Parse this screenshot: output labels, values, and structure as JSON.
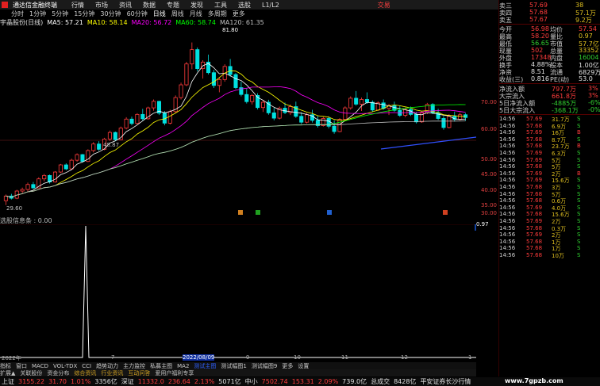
{
  "menubar": {
    "brand": "通达信金融终端",
    "items": [
      "行情",
      "市场",
      "资讯",
      "数据",
      "专题",
      "发现",
      "工具",
      "选股",
      "L1/L2"
    ],
    "trade": "交易"
  },
  "periods": [
    "分时",
    "1分钟",
    "5分钟",
    "15分钟",
    "30分钟",
    "60分钟",
    "日线",
    "周线",
    "月线",
    "多周期",
    "更多"
  ],
  "selected_period": "日线",
  "ma_legend": {
    "stock": "宇晶股份(日线)",
    "items": [
      {
        "label": "MA5: 57.21",
        "color": "#ffffff"
      },
      {
        "label": "MA10: 58.14",
        "color": "#ffff00"
      },
      {
        "label": "MA20: 56.72",
        "color": "#ff00ff"
      },
      {
        "label": "MA60: 58.74",
        "color": "#00ff00"
      },
      {
        "label": "MA120: 61.35",
        "color": "#c0c0c0"
      }
    ]
  },
  "price_axis": [
    "70.00",
    "60.00",
    "50.00",
    "45.00",
    "40.00",
    "35.00",
    "30.00"
  ],
  "annotations": {
    "high": "81.80",
    "mid": "48.87",
    "low": "29.60",
    "ref": "0.97"
  },
  "sub_legend": "选股信息条 : 0.00",
  "dates": [
    "2022年",
    "7",
    "2022/08/09",
    "9",
    "10",
    "11",
    "12",
    "1"
  ],
  "tabs": [
    "指标",
    "窗口",
    "MACD",
    "VOL-TDX",
    "CCI",
    "趋势动力",
    "主力监控",
    "私募主图",
    "MA2",
    "测试主图",
    "测试幅图1",
    "测试幅图9",
    "更多",
    "设置"
  ],
  "bottom_tabs": [
    "扩展▲",
    "关联股份",
    "资金分布",
    "综合资讯",
    "行业资讯",
    "互动问答",
    "爱用户福利专享"
  ],
  "indexes": [
    {
      "name": "上证",
      "value": "3155.22",
      "change": "31.70",
      "pct": "1.01%",
      "amount": "3356亿"
    },
    {
      "name": "深证",
      "value": "11332.0",
      "change": "236.64",
      "pct": "2.13%",
      "amount": "5071亿"
    },
    {
      "name": "中小",
      "value": "7502.74",
      "change": "153.31",
      "pct": "2.09%",
      "amount": "739.0亿"
    }
  ],
  "total_amount": {
    "label": "总成交",
    "value": "8428亿"
  },
  "status_text": "平安证券长沙行情",
  "quotes": {
    "asks": [
      {
        "label": "卖三",
        "price": "57.69",
        "vol": "38"
      },
      {
        "label": "卖四",
        "price": "57.68",
        "vol": "57.1万"
      },
      {
        "label": "卖五",
        "price": "57.67",
        "vol": "9.2万"
      }
    ],
    "stats": [
      {
        "l1": "今开",
        "v1": "56.98",
        "l2": "均价",
        "v2": "57.54"
      },
      {
        "l1": "最高",
        "v1": "58.20",
        "l2": "量比",
        "v2": "0.97"
      },
      {
        "l1": "最低",
        "v1": "56.65",
        "l2": "市值",
        "v2": "57.7亿"
      },
      {
        "l1": "现量",
        "v1": "502",
        "l2": "总量",
        "v2": "33352"
      },
      {
        "l1": "外盘",
        "v1": "17348",
        "l2": "内盘",
        "v2": "16004"
      },
      {
        "l1": "换手",
        "v1": "4.88%",
        "l2": "股本",
        "v2": "1.00亿"
      },
      {
        "l1": "净资",
        "v1": "8.51",
        "l2": "流通",
        "v2": "6829万"
      },
      {
        "l1": "收益(三)",
        "v1": "0.816",
        "l2": "PE(动)",
        "v2": "53.0"
      }
    ],
    "flows": [
      {
        "label": "净流入额",
        "value": "797.7万",
        "pct": "3%"
      },
      {
        "label": "大宗流入",
        "value": "661.8万",
        "pct": "3%"
      },
      {
        "label": "5日净流入额",
        "value": "-4885万",
        "pct": "-6%"
      },
      {
        "label": "5日大宗流入",
        "value": "-368.1万",
        "pct": "-0%"
      }
    ]
  },
  "ticks": [
    {
      "t": "14:56",
      "p": "57.69",
      "v": "31.7万",
      "s": "S"
    },
    {
      "t": "14:56",
      "p": "57.68",
      "v": "6.9万",
      "s": "S"
    },
    {
      "t": "14:56",
      "p": "57.69",
      "v": "16万",
      "s": "B"
    },
    {
      "t": "14:56",
      "p": "57.68",
      "v": "8.7万",
      "s": "S"
    },
    {
      "t": "14:56",
      "p": "57.68",
      "v": "23.7万",
      "s": "B"
    },
    {
      "t": "14:56",
      "p": "57.69",
      "v": "6.3万",
      "s": "S"
    },
    {
      "t": "14:56",
      "p": "57.69",
      "v": "5万",
      "s": "S"
    },
    {
      "t": "14:56",
      "p": "57.68",
      "v": "5万",
      "s": "S"
    },
    {
      "t": "14:56",
      "p": "57.69",
      "v": "2万",
      "s": "B"
    },
    {
      "t": "14:56",
      "p": "57.69",
      "v": "15.6万",
      "s": "S"
    },
    {
      "t": "14:56",
      "p": "57.68",
      "v": "3万",
      "s": "S"
    },
    {
      "t": "14:56",
      "p": "57.68",
      "v": "5万",
      "s": "S"
    },
    {
      "t": "14:56",
      "p": "57.68",
      "v": "0.6万",
      "s": "S"
    },
    {
      "t": "14:56",
      "p": "57.69",
      "v": "4.0万",
      "s": "S"
    },
    {
      "t": "14:56",
      "p": "57.68",
      "v": "15.6万",
      "s": "S"
    },
    {
      "t": "14:56",
      "p": "57.69",
      "v": "2万",
      "s": "S"
    },
    {
      "t": "14:56",
      "p": "57.68",
      "v": "0.3万",
      "s": "S"
    },
    {
      "t": "14:56",
      "p": "57.69",
      "v": "2万",
      "s": "S"
    },
    {
      "t": "14:56",
      "p": "57.68",
      "v": "1万",
      "s": "S"
    },
    {
      "t": "14:56",
      "p": "57.68",
      "v": "1万",
      "s": "S"
    },
    {
      "t": "14:56",
      "p": "57.68",
      "v": "10万",
      "s": "S"
    }
  ],
  "watermark": "www.7gpzb.com",
  "chart_data": {
    "type": "candlestick",
    "ylim": [
      28,
      85
    ],
    "candles": [
      [
        31,
        33,
        29.6,
        32.5
      ],
      [
        32.5,
        33.2,
        31.4,
        31.8
      ],
      [
        31.8,
        34.5,
        31.5,
        34.1
      ],
      [
        34.1,
        35.2,
        33.5,
        34.6
      ],
      [
        34.6,
        36.8,
        34,
        36.2
      ],
      [
        36.2,
        37,
        34.8,
        35.1
      ],
      [
        35.1,
        38.5,
        35,
        38
      ],
      [
        38,
        39.6,
        37.2,
        39.1
      ],
      [
        39.1,
        39.4,
        36.5,
        37
      ],
      [
        37,
        40.5,
        36.8,
        40.2
      ],
      [
        40.2,
        42.8,
        39.9,
        42.5
      ],
      [
        42.5,
        43,
        40.8,
        41.2
      ],
      [
        41.2,
        44.5,
        41,
        44
      ],
      [
        44,
        46.2,
        43.5,
        45.8
      ],
      [
        45.8,
        46,
        43.2,
        43.6
      ],
      [
        43.6,
        47.5,
        43.4,
        47.1
      ],
      [
        47.1,
        49.8,
        46.5,
        49.2
      ],
      [
        49.2,
        50.1,
        47,
        47.5
      ],
      [
        47.5,
        51.2,
        47.2,
        50.8
      ],
      [
        50.8,
        53.5,
        50.2,
        52.9
      ],
      [
        52.9,
        53.2,
        50.1,
        50.6
      ],
      [
        50.6,
        54.8,
        50.4,
        54.3
      ],
      [
        54.3,
        57.8,
        53.9,
        57.2
      ],
      [
        57.2,
        58,
        55.2,
        55.8
      ],
      [
        55.8,
        59.1,
        55.5,
        58.7
      ],
      [
        58.7,
        60.5,
        56.8,
        57.3
      ],
      [
        57.3,
        61.2,
        57,
        60.8
      ],
      [
        60.8,
        63.5,
        59.9,
        62.9
      ],
      [
        62.9,
        63.1,
        58.5,
        59.1
      ],
      [
        59.1,
        59.8,
        55.2,
        55.9
      ],
      [
        55.9,
        60.2,
        55.5,
        59.6
      ],
      [
        59.6,
        64.8,
        59.2,
        64.1
      ],
      [
        64.1,
        68.9,
        63.5,
        68.2
      ],
      [
        68.2,
        75.6,
        67.8,
        74.9
      ],
      [
        74.9,
        81.8,
        73.2,
        79.5
      ],
      [
        79.5,
        80.2,
        72.5,
        73.4
      ],
      [
        73.4,
        76.1,
        70.2,
        75.5
      ],
      [
        75.5,
        77.9,
        71.5,
        72.1
      ],
      [
        72.1,
        73,
        67.2,
        68
      ],
      [
        68,
        70.5,
        65.8,
        69.9
      ],
      [
        69.9,
        74.8,
        69.2,
        74.1
      ],
      [
        74.1,
        76.5,
        70.8,
        71.5
      ],
      [
        71.5,
        72,
        66.8,
        67.3
      ],
      [
        67.3,
        69.2,
        64.5,
        65.1
      ],
      [
        65.1,
        66.9,
        62.2,
        62.8
      ],
      [
        62.8,
        65.3,
        61.9,
        64.8
      ],
      [
        64.8,
        65.5,
        60.3,
        60.9
      ],
      [
        60.9,
        63.2,
        59.5,
        62.6
      ],
      [
        62.6,
        63.4,
        58.6,
        59.2
      ],
      [
        59.2,
        60.8,
        56.8,
        57.5
      ],
      [
        57.5,
        61.2,
        57.1,
        60.7
      ],
      [
        60.7,
        62.5,
        58.8,
        59.3
      ],
      [
        59.3,
        61.9,
        58.5,
        61.2
      ],
      [
        61.2,
        62.8,
        57.6,
        58.1
      ],
      [
        58.1,
        59.4,
        55.6,
        56.2
      ],
      [
        56.2,
        59.1,
        55.8,
        58.6
      ],
      [
        58.6,
        60.2,
        56.1,
        56.8
      ],
      [
        56.8,
        58.3,
        54.5,
        55.1
      ],
      [
        55.1,
        57.9,
        54.8,
        57.4
      ],
      [
        57.4,
        58.1,
        54.2,
        54.9
      ],
      [
        54.9,
        56.8,
        52.5,
        53.2
      ],
      [
        53.2,
        57.5,
        53,
        57.1
      ],
      [
        57.1,
        61.3,
        56.8,
        60.8
      ],
      [
        60.8,
        64.5,
        60.2,
        63.9
      ],
      [
        63.9,
        66.2,
        61.5,
        62
      ],
      [
        62,
        64.1,
        59.8,
        63.5
      ],
      [
        63.5,
        65.8,
        62.1,
        62.6
      ],
      [
        62.6,
        63.2,
        59.5,
        60.1
      ],
      [
        60.1,
        62.9,
        59.8,
        62.4
      ],
      [
        62.4,
        63.5,
        60.2,
        60.6
      ],
      [
        60.6,
        62.1,
        58.5,
        61.5
      ],
      [
        61.5,
        62.8,
        59.6,
        60
      ],
      [
        60,
        61.5,
        57.9,
        58.4
      ],
      [
        58.4,
        60.9,
        57.8,
        60.3
      ],
      [
        60.3,
        61.2,
        58.2,
        58.7
      ],
      [
        58.7,
        59.5,
        55.8,
        56.3
      ],
      [
        56.3,
        59.8,
        56,
        59.2
      ],
      [
        59.2,
        62.4,
        58.8,
        61.9
      ],
      [
        61.9,
        62.3,
        58.8,
        59.2
      ],
      [
        59.2,
        60.5,
        56.9,
        57.4
      ],
      [
        57.4,
        58.2,
        53.8,
        54.5
      ],
      [
        54.5,
        58.8,
        54.2,
        58.1
      ],
      [
        58.1,
        59.6,
        56.4,
        57.1
      ],
      [
        57.1,
        59.3,
        56.8,
        58.6
      ],
      [
        58.6,
        59.1,
        56.7,
        57.7
      ]
    ],
    "subpanel": {
      "label": "选股信息条",
      "value": 0.0
    }
  }
}
